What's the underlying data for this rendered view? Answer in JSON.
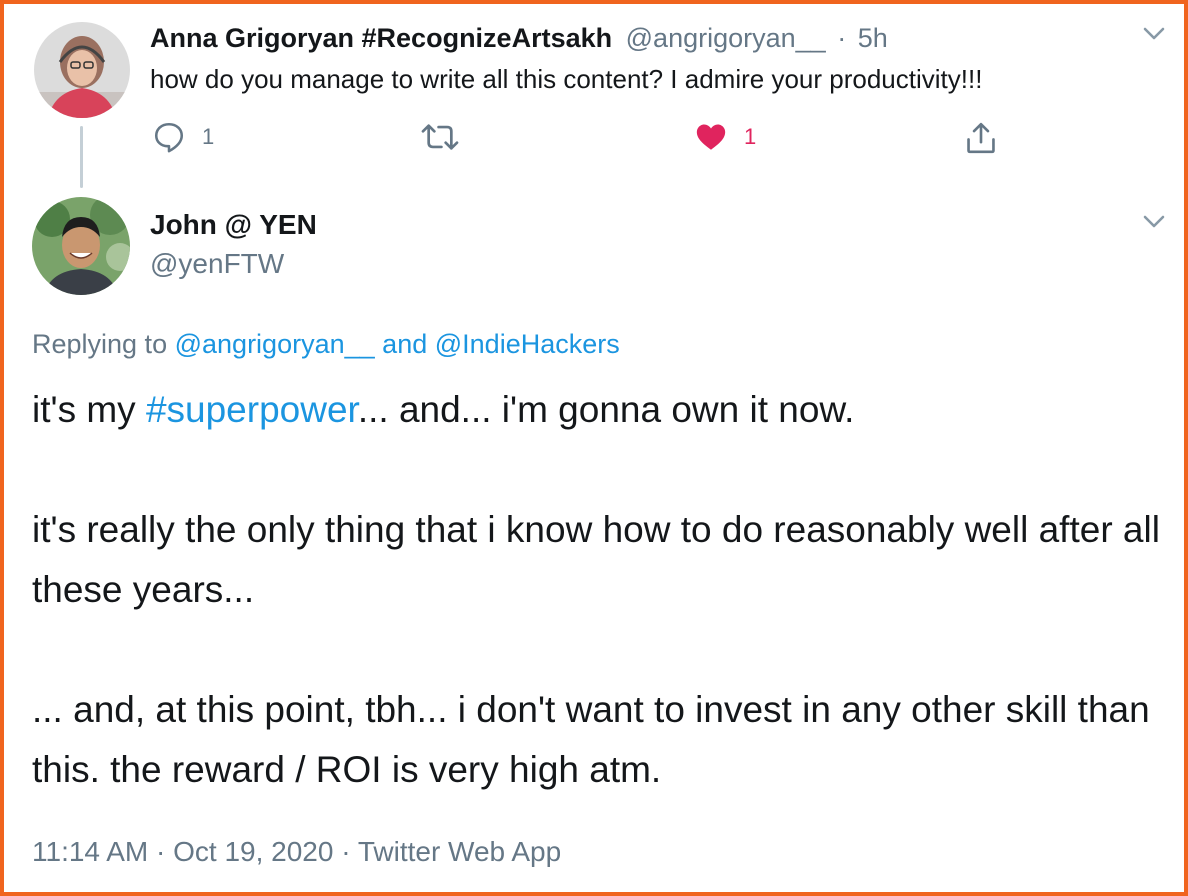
{
  "reply": {
    "display_name": "Anna Grigoryan #RecognizeArtsakh",
    "handle": "@angrigoryan__",
    "separator": "·",
    "time": "5h",
    "text": "how do you manage to write all this content? I admire your productivity!!!",
    "reply_count": "1",
    "like_count": "1",
    "like_color": "#e0245e"
  },
  "main": {
    "display_name": "John @ YEN",
    "handle": "@yenFTW",
    "replying_prefix": "Replying to",
    "replying_user1": "@angrigoryan__",
    "replying_and": "and",
    "replying_user2": "@IndieHackers",
    "line1_pre": "it's my ",
    "hashtag": "#superpower",
    "line1_post": "... and... i'm gonna own it now.",
    "para2": "it's really the only thing that i know how to do reasonably well after all these years...",
    "para3": "... and, at this point, tbh... i don't want to invest in any other skill than this. the reward / ROI is very high atm.",
    "timestamp": "11:14 AM · Oct 19, 2020 · Twitter Web App"
  },
  "colors": {
    "frame": "#f0641e",
    "link": "#1b95e0",
    "muted": "#657786",
    "text": "#14171a"
  },
  "icons": {
    "reply": "speech-bubble-icon",
    "retweet": "retweet-icon",
    "like": "heart-icon",
    "share": "share-icon",
    "menu": "chevron-down-icon"
  }
}
